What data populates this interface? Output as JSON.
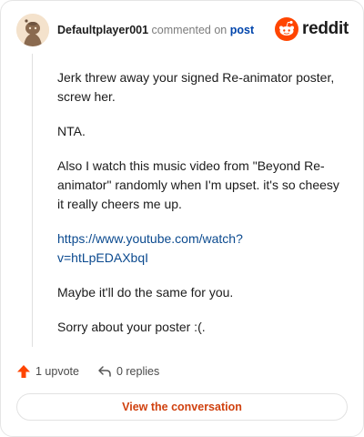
{
  "comment": {
    "author": "Defaultplayer001",
    "action_text": "commented on",
    "post_link": "post",
    "paragraphs": [
      "Jerk threw away your signed Re-animator poster, screw her.",
      "NTA.",
      "Also I watch this music video from \"Beyond Re-animator\" randomly when I'm upset. it's so cheesy it really cheers me up."
    ],
    "link": "https://www.youtube.com/watch?v=htLpEDAXbqI",
    "paragraphs_after": [
      "Maybe it'll do the same for you.",
      "Sorry about your poster :(."
    ]
  },
  "brand": {
    "name": "reddit",
    "color": "#ff4500"
  },
  "actions": {
    "upvotes": "1 upvote",
    "replies": "0 replies"
  },
  "footer": {
    "button_label": "View the conversation"
  }
}
